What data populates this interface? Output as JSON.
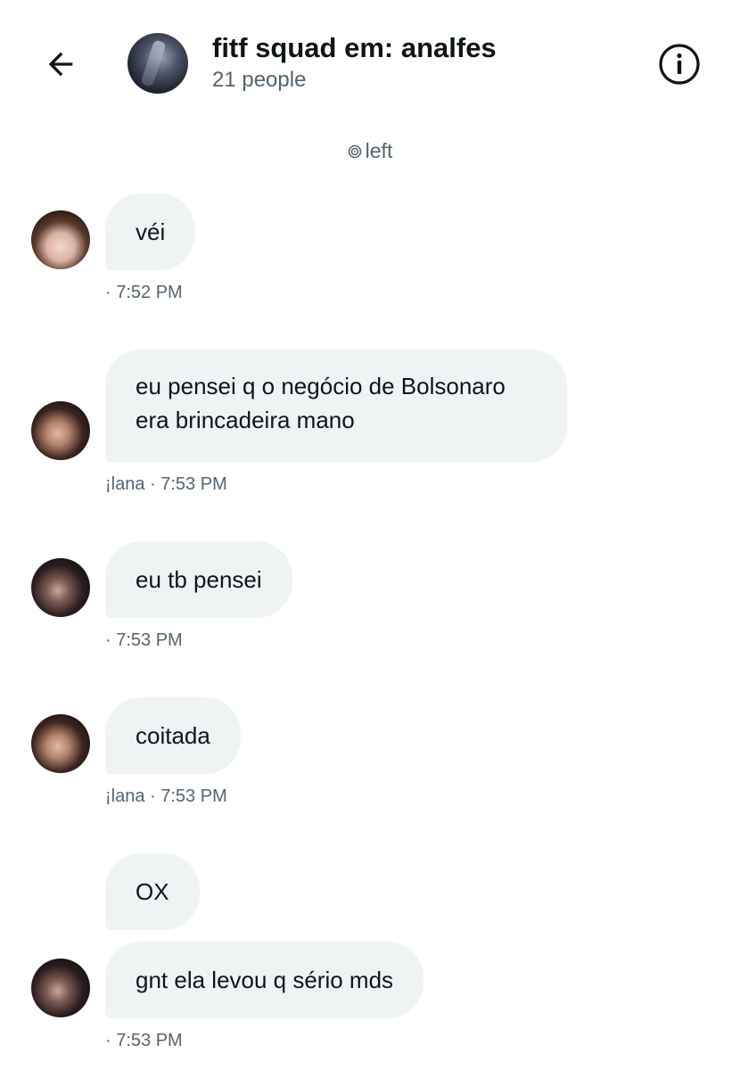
{
  "header": {
    "title": "fitf squad em: analfes",
    "subtitle": "21 people"
  },
  "system_message": {
    "text": "left"
  },
  "messages": [
    {
      "text": "véi",
      "sender": "",
      "time": "7:52 PM"
    },
    {
      "text_line1": "eu pensei q o negócio de Bolsonaro",
      "text_line2": "era brincadeira mano",
      "sender": "¡lana",
      "time": "7:53 PM"
    },
    {
      "text": "eu tb pensei",
      "sender": "",
      "time": "7:53 PM"
    },
    {
      "text": "coitada",
      "sender": "¡lana",
      "time": "7:53 PM"
    },
    {
      "text": "OX"
    },
    {
      "text": "gnt ela levou q sério mds",
      "sender": "",
      "time": "7:53 PM"
    }
  ],
  "meta": {
    "m0": "· 7:52 PM",
    "m1": "¡lana · 7:53 PM",
    "m2": "· 7:53 PM",
    "m3": "¡lana · 7:53 PM",
    "m5": "· 7:53 PM"
  },
  "icons": {
    "back": "arrow-left-icon",
    "info": "info-icon",
    "system": "spiral-icon"
  },
  "colors": {
    "bubble_bg": "#eff3f4",
    "secondary_text": "#536471",
    "primary_text": "#0f1419"
  }
}
